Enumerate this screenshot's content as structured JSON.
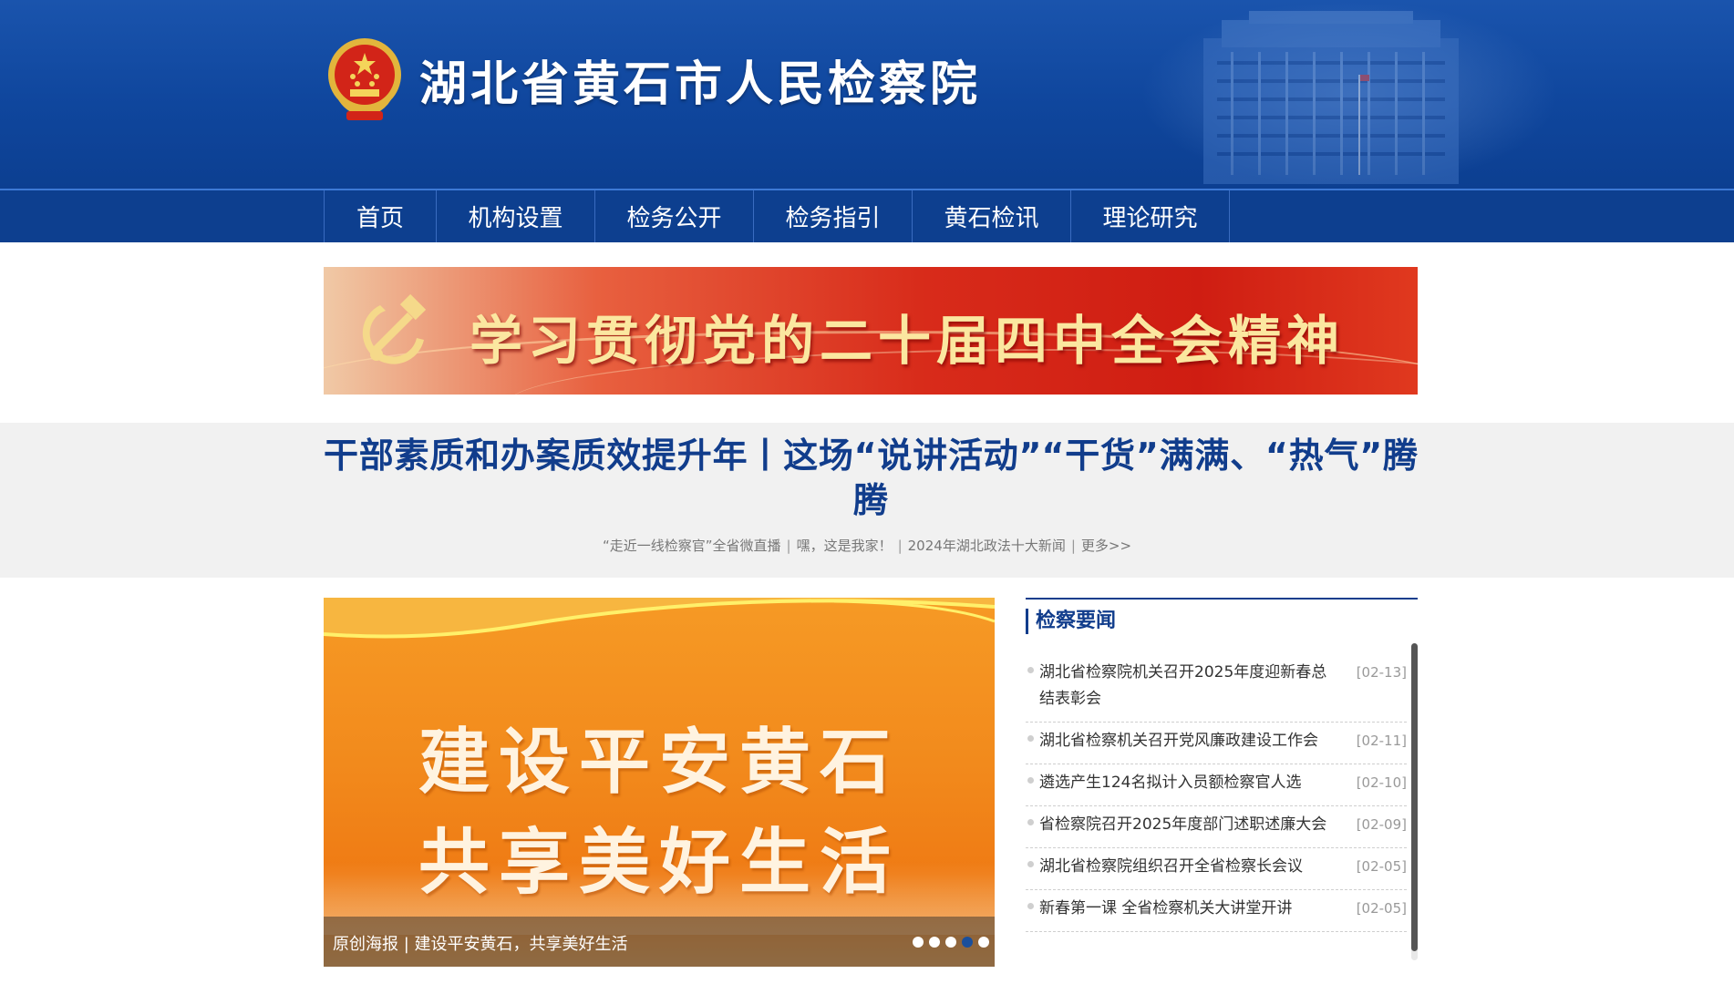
{
  "header": {
    "site_title": "湖北省黄石市人民检察院",
    "emblem_icon": "national-emblem-icon",
    "background_color": "#0f469d"
  },
  "nav": {
    "items": [
      {
        "label": "首页"
      },
      {
        "label": "机构设置"
      },
      {
        "label": "检务公开"
      },
      {
        "label": "检务指引"
      },
      {
        "label": "黄石检讯"
      },
      {
        "label": "理论研究"
      }
    ]
  },
  "banner": {
    "text": "学习贯彻党的二十届四中全会精神",
    "icon": "party-emblem-icon"
  },
  "headline": {
    "title": "干部素质和办案质效提升年丨这场“说讲活动”“干货”满满、“热气”腾腾",
    "sublinks": [
      "“走近一线检察官”全省微直播",
      "嘿，这是我家！",
      "2024年湖北政法十大新闻",
      "更多>>"
    ]
  },
  "slideshow": {
    "lines": [
      "建设平安黄石",
      "共享美好生活"
    ],
    "caption": "原创海报 | 建设平安黄石，共享美好生活",
    "dot_count": 5,
    "active_dot": 4
  },
  "news": {
    "heading": "检察要闻",
    "accent_color": "#113d8c",
    "items": [
      {
        "title": "湖北省检察院机关召开2025年度迎新春总结表彰会",
        "date": "[02-13]"
      },
      {
        "title": "湖北省检察机关召开党风廉政建设工作会",
        "date": "[02-11]"
      },
      {
        "title": "遴选产生124名拟计入员额检察官人选",
        "date": "[02-10]"
      },
      {
        "title": "省检察院召开2025年度部门述职述廉大会",
        "date": "[02-09]"
      },
      {
        "title": "湖北省检察院组织召开全省检察长会议",
        "date": "[02-05]"
      },
      {
        "title": "新春第一课 全省检察机关大讲堂开讲",
        "date": "[02-05]"
      }
    ]
  }
}
